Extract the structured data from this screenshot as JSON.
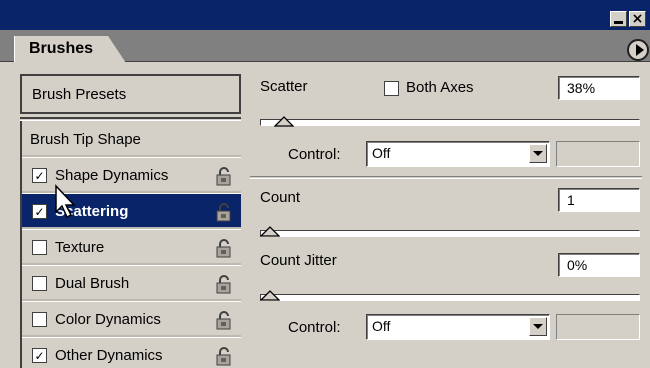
{
  "window": {
    "tab_title": "Brushes"
  },
  "left": {
    "presets_label": "Brush Presets",
    "tip_shape_label": "Brush Tip Shape",
    "items": [
      {
        "label": "Shape Dynamics",
        "checked": true,
        "selected": false
      },
      {
        "label": "Scattering",
        "checked": true,
        "selected": true
      },
      {
        "label": "Texture",
        "checked": false,
        "selected": false
      },
      {
        "label": "Dual Brush",
        "checked": false,
        "selected": false
      },
      {
        "label": "Color Dynamics",
        "checked": false,
        "selected": false
      },
      {
        "label": "Other Dynamics",
        "checked": true,
        "selected": false
      }
    ]
  },
  "scatter": {
    "label": "Scatter",
    "both_axes_label": "Both Axes",
    "both_axes_checked": false,
    "value": "38%",
    "slider_fraction": 0.038,
    "control_label": "Control:",
    "control_value": "Off"
  },
  "count": {
    "label": "Count",
    "value": "1",
    "slider_fraction": 0.0
  },
  "count_jitter": {
    "label": "Count Jitter",
    "value": "0%",
    "slider_fraction": 0.0,
    "control_label": "Control:",
    "control_value": "Off"
  },
  "colors": {
    "selection": "#0a246a",
    "panel": "#d4d0c8"
  }
}
